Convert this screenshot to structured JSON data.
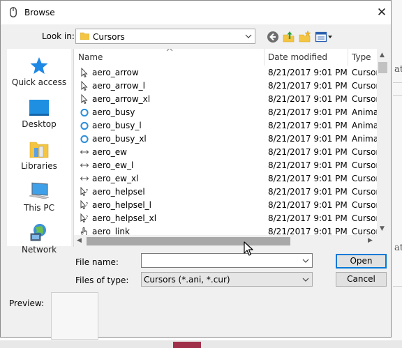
{
  "window": {
    "title": "Browse",
    "close_glyph": "✕"
  },
  "lookin": {
    "label": "Look in:",
    "value": "Cursors"
  },
  "toolbar": {
    "icons": [
      "back-icon",
      "up-folder-icon",
      "new-folder-icon",
      "view-menu-icon"
    ]
  },
  "places": [
    {
      "label": "Quick access",
      "icon": "quick-access-star-icon"
    },
    {
      "label": "Desktop",
      "icon": "desktop-icon"
    },
    {
      "label": "Libraries",
      "icon": "libraries-icon"
    },
    {
      "label": "This PC",
      "icon": "this-pc-icon"
    },
    {
      "label": "Network",
      "icon": "network-icon"
    }
  ],
  "filelist": {
    "columns": {
      "name": "Name",
      "date": "Date modified",
      "type": "Type"
    },
    "rows": [
      {
        "name": "aero_arrow",
        "date": "8/21/2017 9:01 PM",
        "type": "Cursor",
        "icon": "arrow-cursor-icon"
      },
      {
        "name": "aero_arrow_l",
        "date": "8/21/2017 9:01 PM",
        "type": "Cursor",
        "icon": "arrow-cursor-icon"
      },
      {
        "name": "aero_arrow_xl",
        "date": "8/21/2017 9:01 PM",
        "type": "Cursor",
        "icon": "arrow-cursor-icon"
      },
      {
        "name": "aero_busy",
        "date": "8/21/2017 9:01 PM",
        "type": "Anima",
        "icon": "busy-ring-icon"
      },
      {
        "name": "aero_busy_l",
        "date": "8/21/2017 9:01 PM",
        "type": "Anima",
        "icon": "busy-ring-icon"
      },
      {
        "name": "aero_busy_xl",
        "date": "8/21/2017 9:01 PM",
        "type": "Anima",
        "icon": "busy-ring-icon"
      },
      {
        "name": "aero_ew",
        "date": "8/21/2017 9:01 PM",
        "type": "Cursor",
        "icon": "resize-ew-icon"
      },
      {
        "name": "aero_ew_l",
        "date": "8/21/2017 9:01 PM",
        "type": "Cursor",
        "icon": "resize-ew-icon"
      },
      {
        "name": "aero_ew_xl",
        "date": "8/21/2017 9:01 PM",
        "type": "Cursor",
        "icon": "resize-ew-icon"
      },
      {
        "name": "aero_helpsel",
        "date": "8/21/2017 9:01 PM",
        "type": "Cursor",
        "icon": "help-cursor-icon"
      },
      {
        "name": "aero_helpsel_l",
        "date": "8/21/2017 9:01 PM",
        "type": "Cursor",
        "icon": "help-cursor-icon"
      },
      {
        "name": "aero_helpsel_xl",
        "date": "8/21/2017 9:01 PM",
        "type": "Cursor",
        "icon": "help-cursor-icon"
      },
      {
        "name": "aero_link",
        "date": "8/21/2017 9:01 PM",
        "type": "Cursor",
        "icon": "hand-cursor-icon"
      }
    ]
  },
  "filename": {
    "label": "File name:",
    "value": ""
  },
  "filetype": {
    "label": "Files of type:",
    "value": "Cursors (*.ani, *.cur)"
  },
  "buttons": {
    "open": "Open",
    "cancel": "Cancel"
  },
  "preview": {
    "label": "Preview:"
  },
  "background_app": {
    "glyph": "ath"
  },
  "colors": {
    "accent": "#0078d7",
    "busy_ring": "#2f8fdb",
    "folder": "#f4c542"
  }
}
